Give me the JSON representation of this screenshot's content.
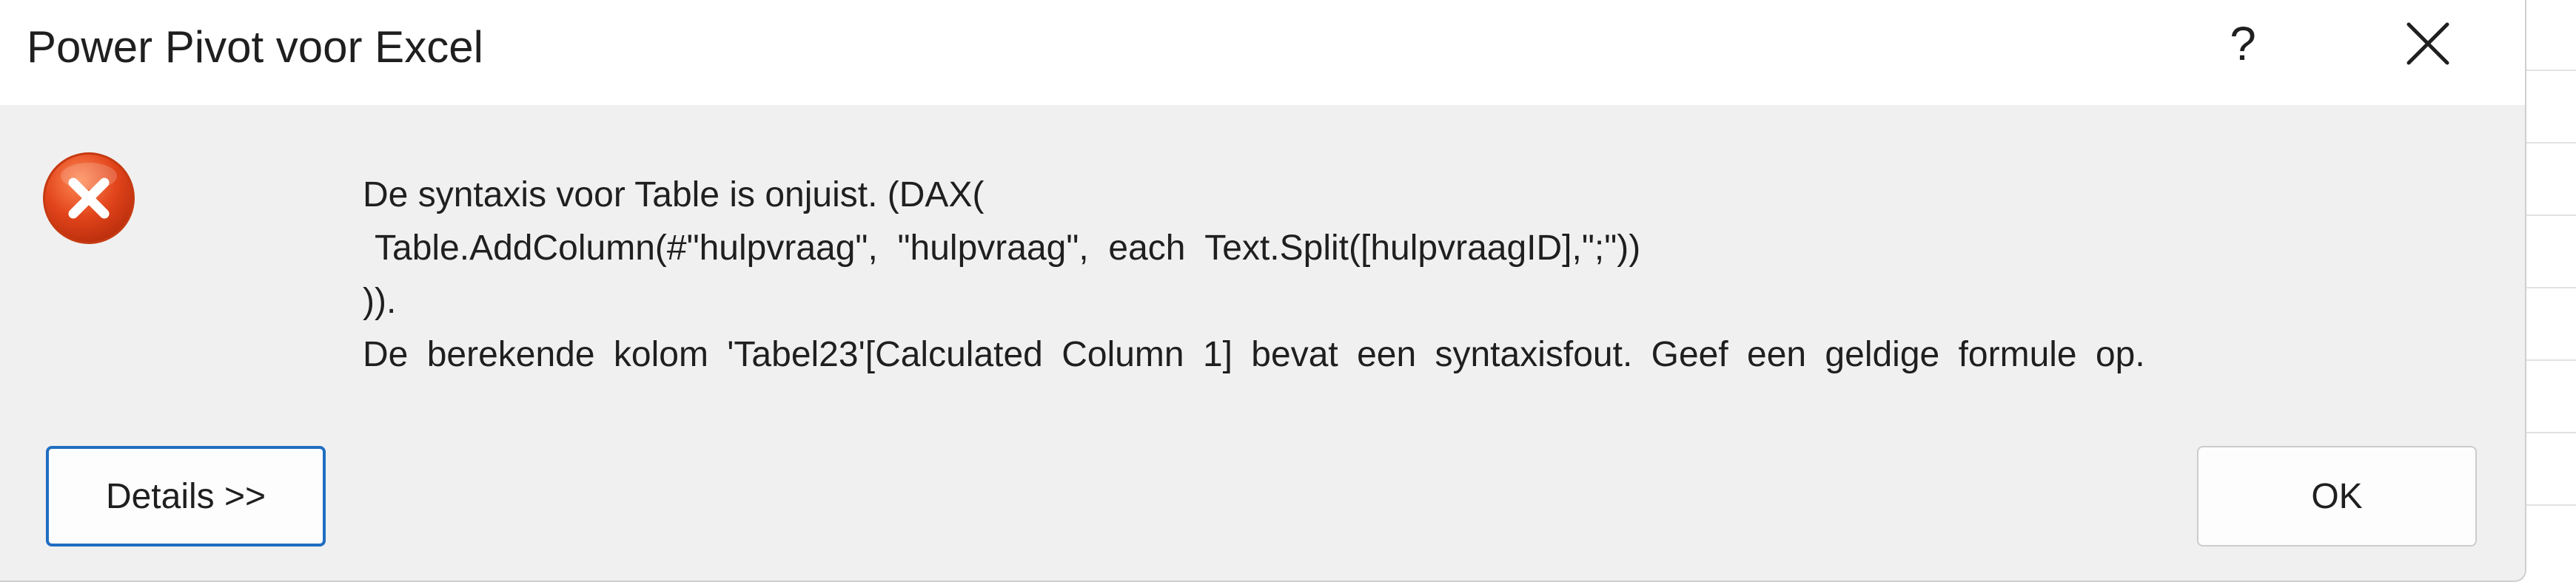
{
  "dialog": {
    "title": "Power Pivot voor Excel",
    "help_label": "?",
    "close_icon": "close-icon",
    "error_icon": "error-circle-x-icon",
    "accent_color": "#1f6ec2",
    "error_color": "#e2451b"
  },
  "message": {
    "line1": "De syntaxis voor Table is onjuist. (DAX(",
    "line2": "Table.AddColumn(#\"hulpvraag\",  \"hulpvraag\",  each  Text.Split([hulpvraagID],\";\"))",
    "line3": ")).",
    "line4": "De berekende kolom 'Tabel23'[Calculated Column 1] bevat een syntaxisfout. Geef een geldige formule op."
  },
  "buttons": {
    "details_label": "Details >>",
    "ok_label": "OK"
  }
}
